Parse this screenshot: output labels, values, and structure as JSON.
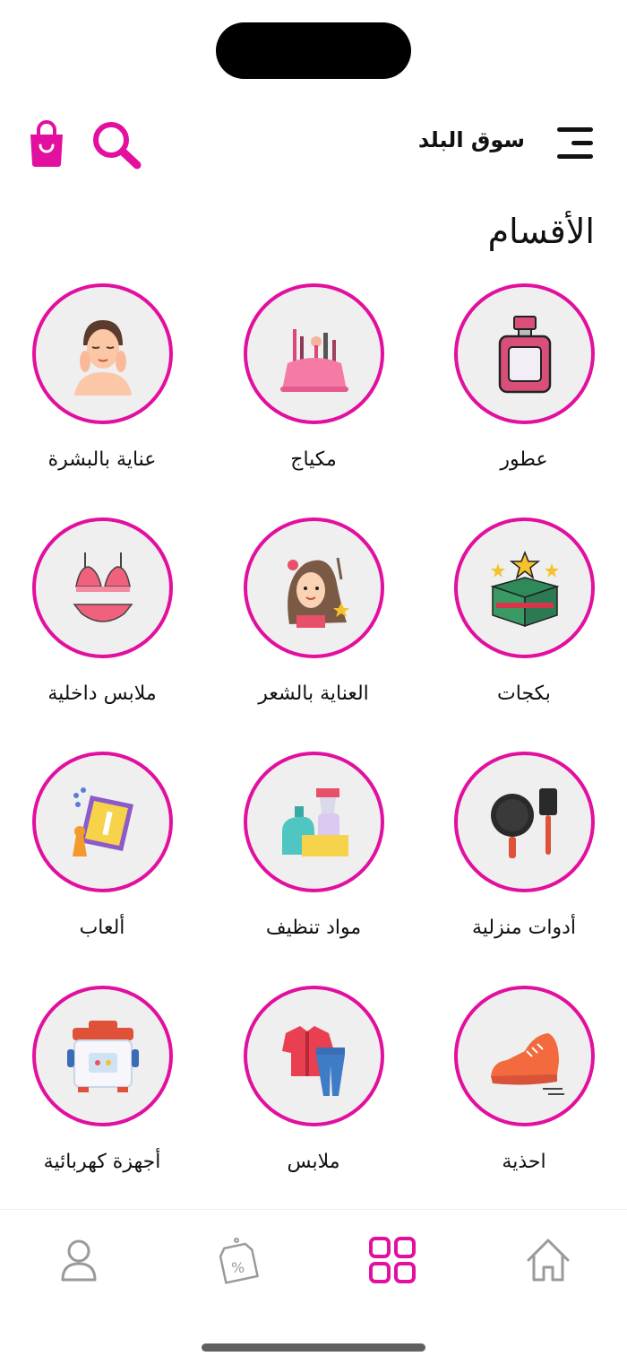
{
  "header": {
    "title": "سوق البلد",
    "icons": {
      "menu": "menu-icon",
      "search": "search-icon",
      "cart": "shopping-bag-icon"
    }
  },
  "section_title": "الأقسام",
  "accent_color": "#e20f9f",
  "categories": [
    {
      "label": "عطور",
      "icon": "perfume-icon"
    },
    {
      "label": "مكياج",
      "icon": "makeup-icon"
    },
    {
      "label": "عناية بالبشرة",
      "icon": "skincare-icon"
    },
    {
      "label": "بكجات",
      "icon": "gift-box-icon"
    },
    {
      "label": "العناية بالشعر",
      "icon": "hair-care-icon"
    },
    {
      "label": "ملابس داخلية",
      "icon": "lingerie-icon"
    },
    {
      "label": "أدوات منزلية",
      "icon": "kitchen-tools-icon"
    },
    {
      "label": "مواد تنظيف",
      "icon": "cleaning-supplies-icon"
    },
    {
      "label": "ألعاب",
      "icon": "toys-icon"
    },
    {
      "label": "احذية",
      "icon": "shoe-icon"
    },
    {
      "label": "ملابس",
      "icon": "clothes-icon"
    },
    {
      "label": "أجهزة كهربائية",
      "icon": "appliance-icon"
    }
  ],
  "bottom_nav": [
    {
      "name": "home",
      "icon": "home-icon",
      "active": false
    },
    {
      "name": "categories",
      "icon": "grid-icon",
      "active": true
    },
    {
      "name": "offers",
      "icon": "discount-tag-icon",
      "active": false
    },
    {
      "name": "profile",
      "icon": "user-icon",
      "active": false
    }
  ]
}
